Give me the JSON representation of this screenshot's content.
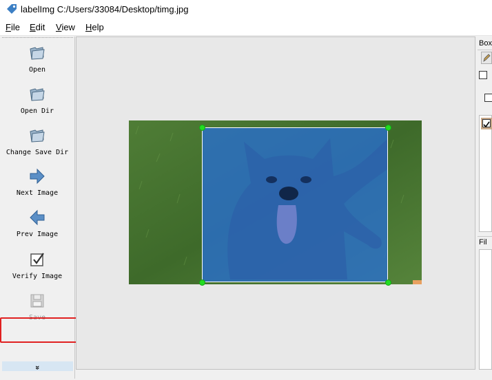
{
  "window": {
    "title": "labelImg C:/Users/33084/Desktop/timg.jpg",
    "icon": "tag-icon"
  },
  "menu": {
    "file": "File",
    "edit": "Edit",
    "view": "View",
    "help": "Help"
  },
  "toolbar": {
    "items": [
      {
        "label": "Open",
        "icon": "folder-open-icon",
        "enabled": true
      },
      {
        "label": "Open Dir",
        "icon": "folder-open-icon",
        "enabled": true
      },
      {
        "label": "Change Save Dir",
        "icon": "folder-open-icon",
        "enabled": true
      },
      {
        "label": "Next Image",
        "icon": "arrow-right-icon",
        "enabled": true
      },
      {
        "label": "Prev Image",
        "icon": "arrow-left-icon",
        "enabled": true
      },
      {
        "label": "Verify Image",
        "icon": "checkbox-icon",
        "enabled": true
      },
      {
        "label": "Save",
        "icon": "floppy-disk-icon",
        "enabled": false
      }
    ],
    "expand_glyph": "»"
  },
  "right_dock": {
    "box_panel_title": "Box",
    "file_panel_title": "Fil"
  },
  "colors": {
    "bbox_fill": "#286ed2",
    "handle": "#22dd22",
    "highlight": "#e02020"
  }
}
